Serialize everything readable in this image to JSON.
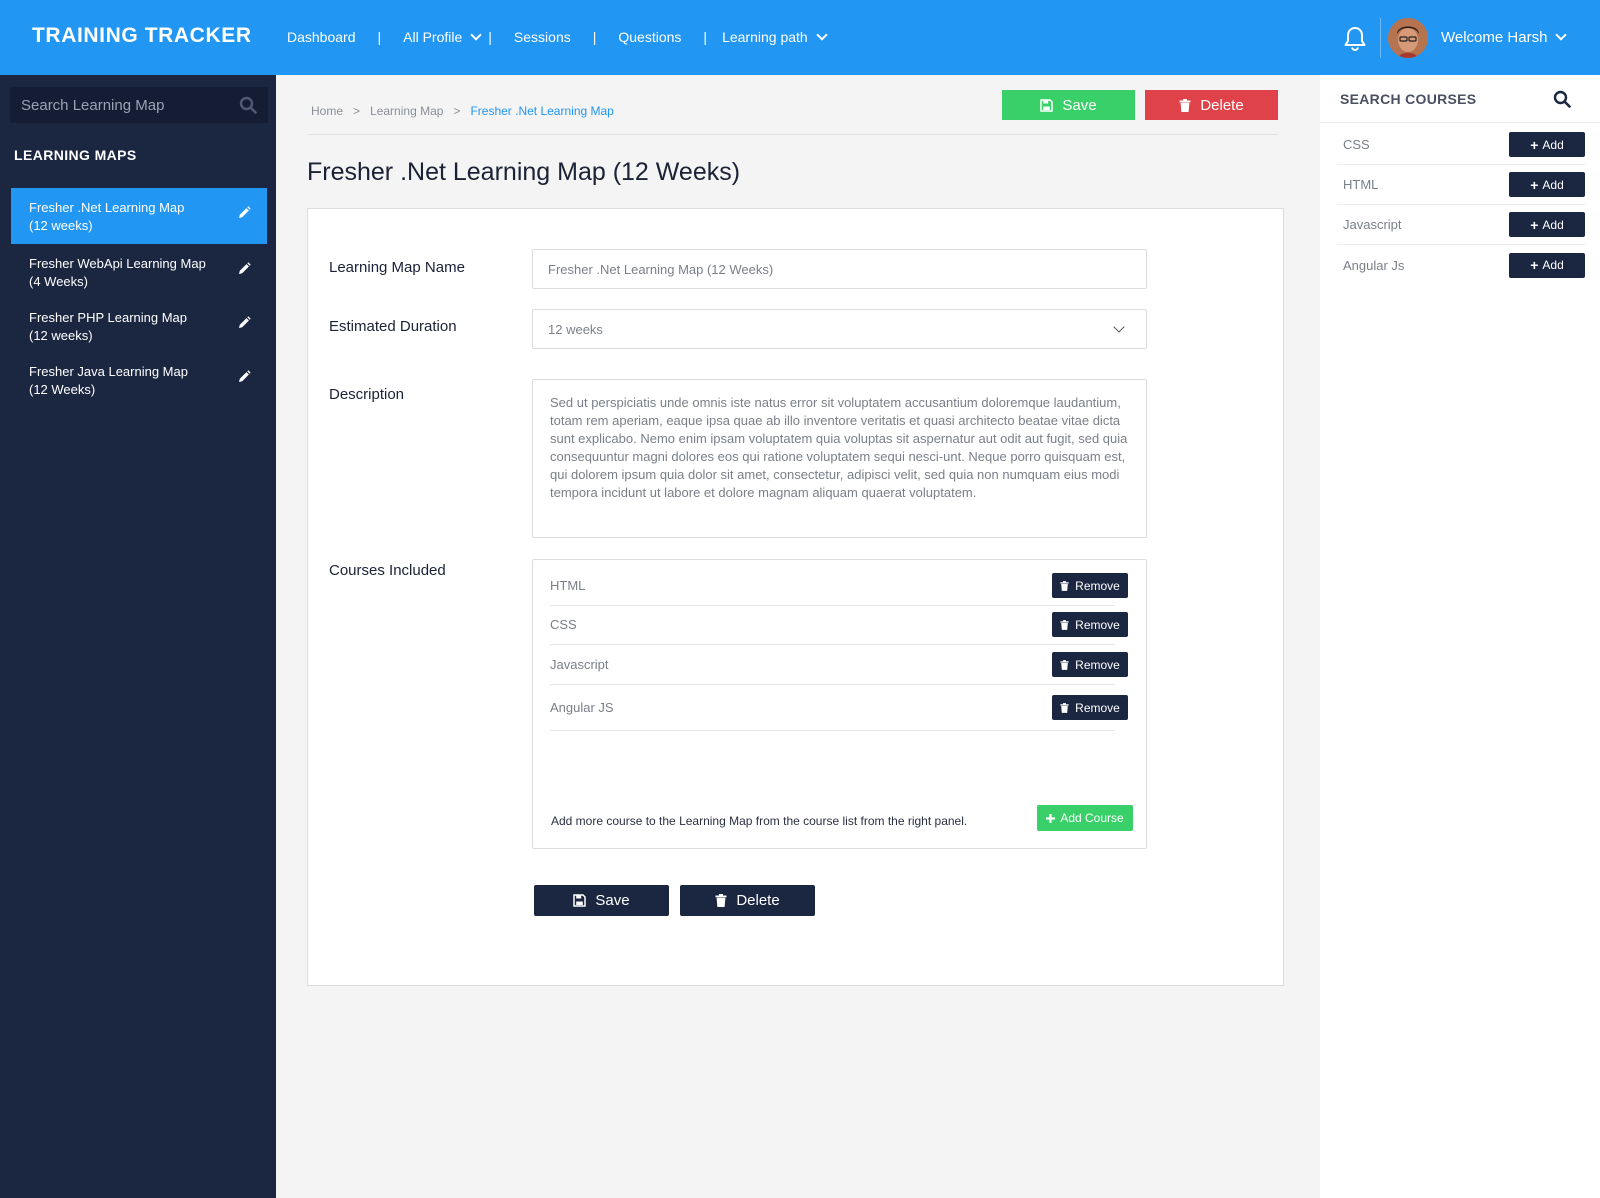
{
  "app": {
    "title": "TRAINING TRACKER"
  },
  "nav": {
    "items": [
      {
        "label": "Dashboard",
        "has_dropdown": false
      },
      {
        "label": "All Profile",
        "has_dropdown": true
      },
      {
        "label": "Sessions",
        "has_dropdown": false
      },
      {
        "label": "Questions",
        "has_dropdown": false
      },
      {
        "label": "Learning path",
        "has_dropdown": true
      }
    ],
    "separator": "|"
  },
  "user": {
    "welcome": "Welcome Harsh"
  },
  "sidebar": {
    "search_placeholder": "Search Learning Map",
    "title": "LEARNING MAPS",
    "items": [
      {
        "label_line1": "Fresher .Net Learning Map",
        "label_line2": "(12 weeks)",
        "active": true
      },
      {
        "label_line1": "Fresher WebApi Learning Map",
        "label_line2": "(4 Weeks)",
        "active": false
      },
      {
        "label_line1": "Fresher PHP Learning Map",
        "label_line2": "(12 weeks)",
        "active": false
      },
      {
        "label_line1": "Fresher Java Learning Map",
        "label_line2": "(12 Weeks)",
        "active": false
      }
    ]
  },
  "breadcrumb": {
    "items": [
      "Home",
      ">",
      "Learning Map",
      ">"
    ],
    "current": "Fresher .Net Learning Map"
  },
  "toolbar": {
    "save_label": "Save",
    "delete_label": "Delete"
  },
  "page": {
    "title": "Fresher .Net Learning Map (12 Weeks)"
  },
  "form": {
    "name_label": "Learning Map Name",
    "name_value": "Fresher .Net Learning Map (12 Weeks)",
    "duration_label": "Estimated Duration",
    "duration_value": "12 weeks",
    "description_label": "Description",
    "description_value": "Sed ut perspiciatis unde omnis iste natus error sit voluptatem accusantium doloremque laudantium, totam rem aperiam, eaque ipsa quae ab illo inventore veritatis et quasi architecto beatae vitae dicta sunt explicabo. Nemo enim ipsam voluptatem quia voluptas sit aspernatur aut odit aut fugit, sed quia consequuntur magni dolores eos qui ratione voluptatem sequi nesci-unt. Neque porro quisquam est, qui dolorem ipsum quia dolor sit amet, consectetur, adipisci velit, sed quia non numquam eius modi tempora incidunt ut labore et dolore magnam aliquam quaerat voluptatem.",
    "courses_label": "Courses Included",
    "courses": [
      "HTML",
      "CSS",
      "Javascript",
      "Angular JS"
    ],
    "remove_label": "Remove",
    "courses_hint": "Add more course to the Learning Map from the course list from the right panel.",
    "add_course_label": "Add Course",
    "save_label": "Save",
    "delete_label": "Delete"
  },
  "rightpanel": {
    "title": "SEARCH COURSES",
    "courses": [
      "CSS",
      "HTML",
      "Javascript",
      "Angular Js"
    ],
    "add_label": "Add"
  },
  "colors": {
    "primary": "#2196f3",
    "sidebar": "#1b2641",
    "success": "#39d06a",
    "danger": "#e0424a"
  }
}
